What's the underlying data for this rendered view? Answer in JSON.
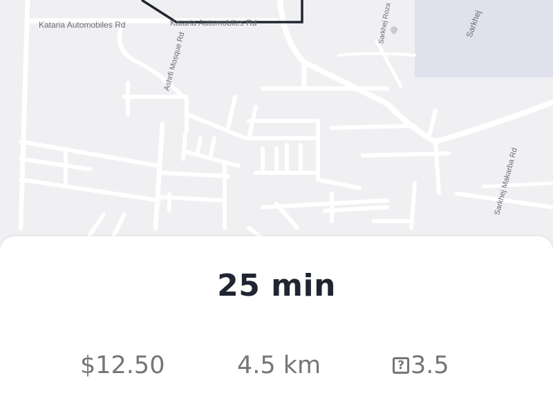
{
  "map": {
    "road_labels": [
      "Kataria Automobiles Rd",
      "Kataria Automobiles Rd",
      "Ashrfi Mosque Rd",
      "Sarkhej Roza",
      "Sarkhej",
      "Sarkhej Makarba Rd"
    ],
    "colors": {
      "background": "#f0f0f3",
      "road": "#ffffff",
      "route": "#1f2631",
      "block": "#dfe1ec"
    }
  },
  "trip": {
    "eta": "25 min",
    "price": "$12.50",
    "distance": "4.5 km",
    "rating": "3.5",
    "rating_icon": "unknown-glyph-icon",
    "rating_icon_glyph": "?"
  }
}
